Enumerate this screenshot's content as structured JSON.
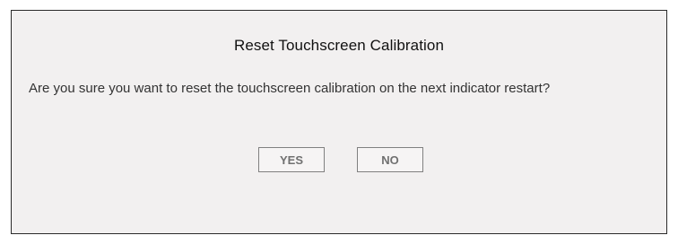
{
  "dialog": {
    "title": "Reset Touchscreen Calibration",
    "message": "Are you sure you want to reset the touchscreen calibration on the next indicator restart?",
    "yes_label": "YES",
    "no_label": "NO"
  }
}
